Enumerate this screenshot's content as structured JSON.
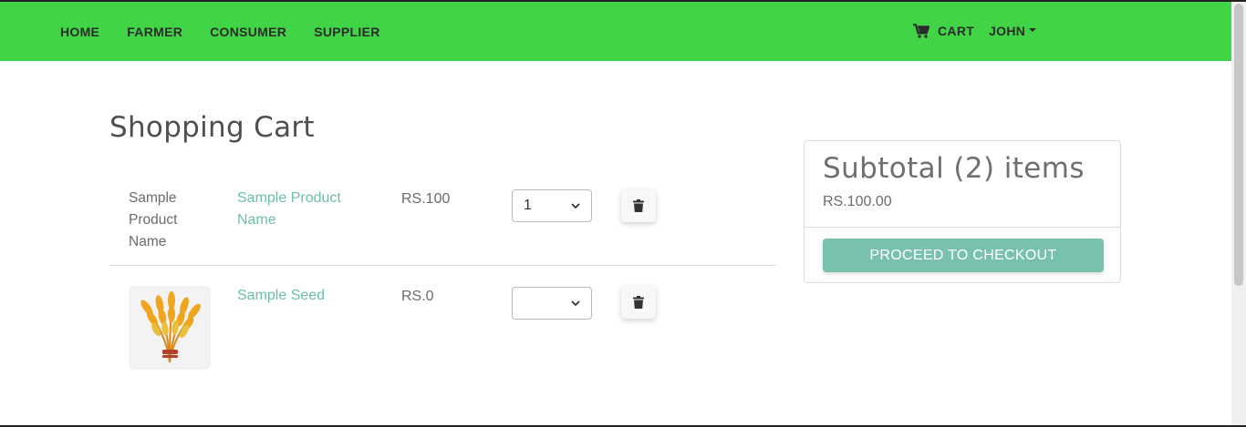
{
  "nav": {
    "links": [
      "HOME",
      "FARMER",
      "CONSUMER",
      "SUPPLIER"
    ],
    "cart_label": "CART",
    "user_label": "JOHN"
  },
  "page": {
    "title": "Shopping Cart"
  },
  "cart": {
    "items": [
      {
        "image_alt": "Sample Product Name",
        "name": "Sample Product Name",
        "price": "RS.100",
        "quantity": "1"
      },
      {
        "image_alt": "",
        "name": "Sample Seed",
        "price": "RS.0",
        "quantity": ""
      }
    ]
  },
  "summary": {
    "title": "Subtotal (2) items",
    "total": "RS.100.00",
    "checkout_label": "PROCEED TO CHECKOUT"
  },
  "colors": {
    "navbar": "#41d446",
    "accent": "#78c2ad",
    "link": "#6bbfa7"
  },
  "icons": {
    "cart": "shopping-cart-icon",
    "delete": "trash-icon",
    "dropdown": "chevron-down-icon",
    "user_menu": "caret-down-icon"
  }
}
